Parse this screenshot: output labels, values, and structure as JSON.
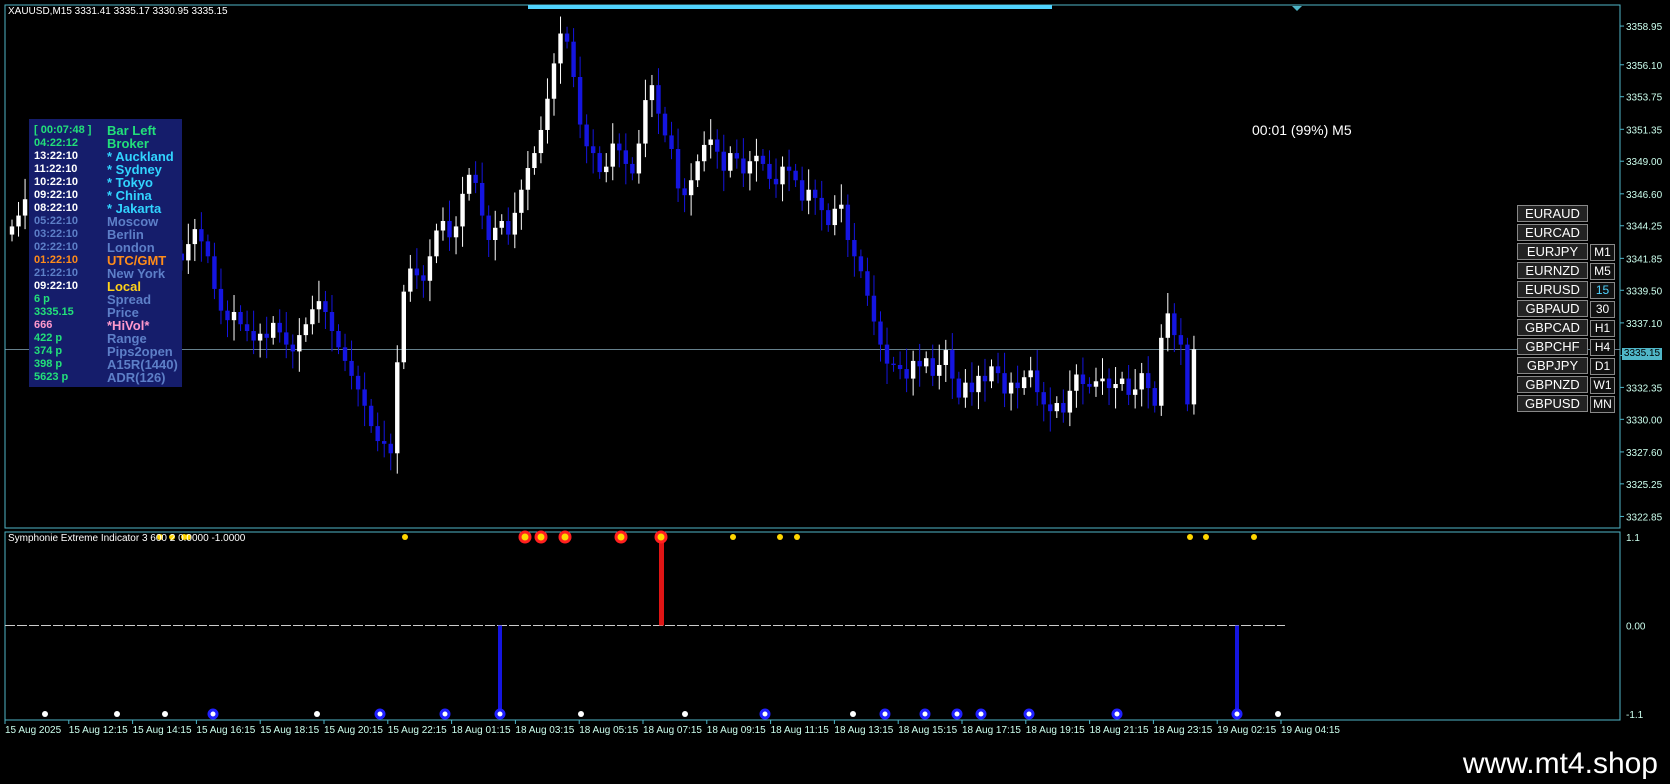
{
  "window": {
    "title": "XAUUSD,M15  3331.41 3335.17 3330.95 3335.15",
    "timer": "00:01 (99%) M5",
    "current_price_tag": "3335.15",
    "footer_text": "www.mt4.shop"
  },
  "clock_panel": {
    "rows": [
      {
        "time": "[ 00:07:48 ]",
        "label": "Bar Left",
        "time_color": "#22e07a",
        "label_color": "#22e07a"
      },
      {
        "time": "04:22:12",
        "label": "Broker",
        "time_color": "#22e07a",
        "label_color": "#22e07a"
      },
      {
        "time": "13:22:10",
        "label": "* Auckland",
        "time_color": "#ffffff",
        "label_color": "#31d4ff"
      },
      {
        "time": "11:22:10",
        "label": "* Sydney",
        "time_color": "#ffffff",
        "label_color": "#31d4ff"
      },
      {
        "time": "10:22:10",
        "label": "* Tokyo",
        "time_color": "#ffffff",
        "label_color": "#31d4ff"
      },
      {
        "time": "09:22:10",
        "label": "* China",
        "time_color": "#ffffff",
        "label_color": "#31d4ff"
      },
      {
        "time": "08:22:10",
        "label": "* Jakarta",
        "time_color": "#ffffff",
        "label_color": "#31d4ff"
      },
      {
        "time": "05:22:10",
        "label": "Moscow",
        "time_color": "#5d7fc8",
        "label_color": "#5d7fc8"
      },
      {
        "time": "03:22:10",
        "label": "Berlin",
        "time_color": "#5d7fc8",
        "label_color": "#5d7fc8"
      },
      {
        "time": "02:22:10",
        "label": "London",
        "time_color": "#5d7fc8",
        "label_color": "#5d7fc8"
      },
      {
        "time": "01:22:10",
        "label": "UTC/GMT",
        "time_color": "#ff8c1a",
        "label_color": "#ff8c1a"
      },
      {
        "time": "21:22:10",
        "label": "New York",
        "time_color": "#5d7fc8",
        "label_color": "#5d7fc8"
      },
      {
        "time": "09:22:10",
        "label": "Local",
        "time_color": "#ffffff",
        "label_color": "#ffd21a"
      },
      {
        "time": "6 p",
        "label": "Spread",
        "time_color": "#22e07a",
        "label_color": "#5d7fc8"
      },
      {
        "time": "3335.15",
        "label": "Price",
        "time_color": "#22e07a",
        "label_color": "#5d7fc8"
      },
      {
        "time": "666",
        "label": "*HiVol*",
        "time_color": "#ff99cc",
        "label_color": "#ff99cc"
      },
      {
        "time": "422 p",
        "label": "Range",
        "time_color": "#22e07a",
        "label_color": "#5d7fc8"
      },
      {
        "time": "374 p",
        "label": "Pips2open",
        "time_color": "#22e07a",
        "label_color": "#5d7fc8"
      },
      {
        "time": "398 p",
        "label": "A15R(1440)",
        "time_color": "#22e07a",
        "label_color": "#5d7fc8"
      },
      {
        "time": "5623 p",
        "label": "ADR(126)",
        "time_color": "#22e07a",
        "label_color": "#5d7fc8"
      }
    ]
  },
  "symbol_buttons": [
    "EURAUD",
    "EURCAD",
    "EURJPY",
    "EURNZD",
    "EURUSD",
    "GBPAUD",
    "GBPCAD",
    "GBPCHF",
    "GBPJPY",
    "GBPNZD",
    "GBPUSD"
  ],
  "timeframe_buttons": [
    "M1",
    "M5",
    "15",
    "30",
    "H1",
    "H4",
    "D1",
    "W1",
    "MN"
  ],
  "active_timeframe": "15",
  "indicator": {
    "title": "Symphonie Extreme Indicator 3 600 2 0.0000 -1.0000",
    "axis_labels": [
      "1.1",
      "0.00",
      "-1.1"
    ]
  },
  "chart_data": {
    "type": "candlestick",
    "symbol": "XAUUSD",
    "timeframe": "M15",
    "price_axis_labels": [
      "3358.95",
      "3356.10",
      "3353.75",
      "3351.35",
      "3349.00",
      "3346.60",
      "3344.25",
      "3341.85",
      "3339.50",
      "3337.10",
      "3334.70",
      "3332.35",
      "3330.00",
      "3327.60",
      "3325.25",
      "3322.85"
    ],
    "time_axis_labels": [
      "15 Aug 2025",
      "15 Aug 12:15",
      "15 Aug 14:15",
      "15 Aug 16:15",
      "15 Aug 18:15",
      "15 Aug 20:15",
      "15 Aug 22:15",
      "18 Aug 01:15",
      "18 Aug 03:15",
      "18 Aug 05:15",
      "18 Aug 07:15",
      "18 Aug 09:15",
      "18 Aug 11:15",
      "18 Aug 13:15",
      "18 Aug 15:15",
      "18 Aug 17:15",
      "18 Aug 19:15",
      "18 Aug 21:15",
      "18 Aug 23:15",
      "19 Aug 02:15",
      "19 Aug 04:15"
    ],
    "ylim": [
      3322.0,
      3360.5
    ],
    "current_price": 3335.15,
    "close_prices": [
      3344.2,
      3345.0,
      3346.2,
      3346.8,
      3345.6,
      3344.4,
      3342.0,
      3340.3,
      3339.0,
      3341.5,
      3343.3,
      3342.8,
      3341.8,
      3339.4,
      3337.6,
      3336.7,
      3336.2,
      3336.9,
      3337.5,
      3335.9,
      3335.1,
      3336.3,
      3337.8,
      3339.0,
      3340.9,
      3342.2,
      3341.7,
      3342.9,
      3344.0,
      3343.1,
      3342.0,
      3339.6,
      3338.0,
      3337.3,
      3337.9,
      3337.0,
      3336.5,
      3335.8,
      3336.3,
      3336.0,
      3337.1,
      3336.4,
      3335.5,
      3335.0,
      3336.2,
      3337.0,
      3338.1,
      3338.7,
      3337.9,
      3336.5,
      3335.3,
      3334.3,
      3333.2,
      3332.2,
      3331.0,
      3329.5,
      3328.4,
      3328.2,
      3327.5,
      3334.2,
      3339.4,
      3341.1,
      3340.6,
      3340.2,
      3342.0,
      3343.9,
      3344.6,
      3343.4,
      3344.2,
      3346.6,
      3348.0,
      3347.4,
      3345.0,
      3343.2,
      3344.1,
      3344.6,
      3343.6,
      3345.2,
      3346.9,
      3348.5,
      3349.6,
      3351.3,
      3353.6,
      3356.2,
      3358.4,
      3357.8,
      3355.2,
      3351.7,
      3350.1,
      3349.6,
      3348.2,
      3348.6,
      3350.3,
      3349.8,
      3348.8,
      3348.1,
      3350.3,
      3353.5,
      3354.6,
      3352.5,
      3350.9,
      3349.9,
      3347.0,
      3346.5,
      3347.6,
      3349.0,
      3350.2,
      3350.6,
      3349.7,
      3348.3,
      3349.6,
      3349.2,
      3348.1,
      3349.0,
      3349.4,
      3348.8,
      3347.7,
      3347.3,
      3348.6,
      3348.3,
      3347.6,
      3346.1,
      3346.9,
      3346.3,
      3345.4,
      3344.3,
      3345.5,
      3345.8,
      3343.2,
      3342.0,
      3340.9,
      3339.1,
      3337.2,
      3335.5,
      3334.1,
      3334.0,
      3333.7,
      3333.0,
      3334.3,
      3333.9,
      3334.5,
      3333.2,
      3334.0,
      3335.1,
      3333.0,
      3331.6,
      3332.7,
      3332.0,
      3333.2,
      3332.8,
      3333.9,
      3333.4,
      3331.9,
      3332.7,
      3332.3,
      3333.1,
      3333.6,
      3332.0,
      3331.1,
      3330.6,
      3331.2,
      3330.5,
      3332.1,
      3333.3,
      3332.6,
      3332.4,
      3332.8,
      3333.0,
      3332.3,
      3332.6,
      3333.0,
      3331.8,
      3332.2,
      3333.4,
      3332.3,
      3331.0,
      3336.0,
      3337.8,
      3336.2,
      3335.5,
      3331.1,
      3335.15
    ]
  },
  "indicator_markers": {
    "top_x_labels_index": [
      0,
      20,
      40,
      60,
      80,
      100,
      120
    ],
    "top_dots_yellow": [
      "15 Aug 12:15",
      "15 Aug 16:15"
    ],
    "spike_down_at": [
      "18 Aug 01:15",
      "19 Aug 02:15"
    ],
    "spike_up_at": [
      "18 Aug 07:15"
    ]
  }
}
